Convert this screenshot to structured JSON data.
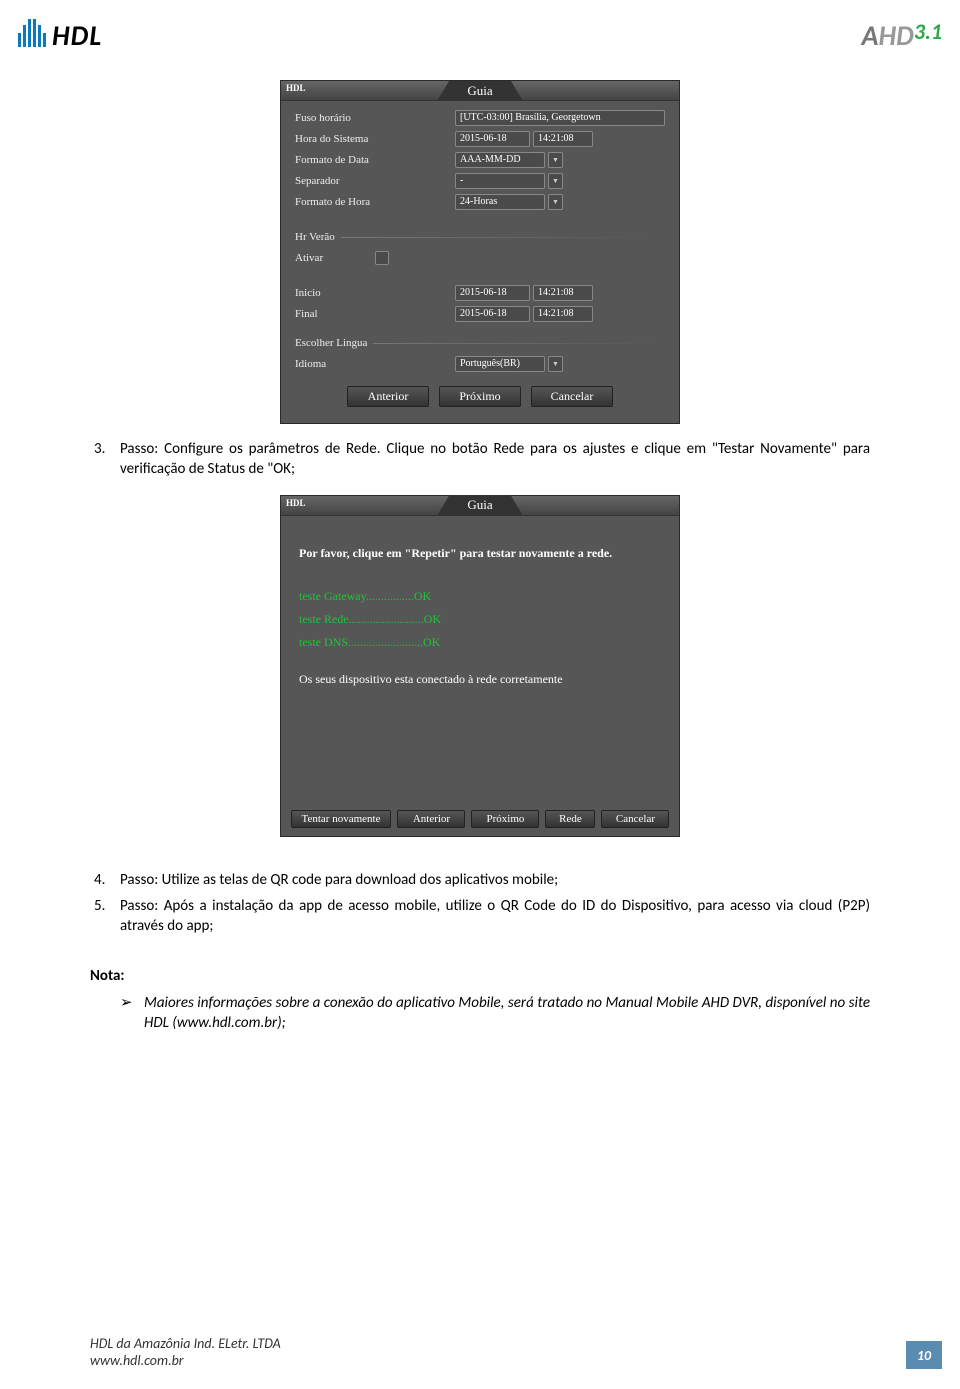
{
  "header": {
    "hdl_logo_text": "HDL",
    "ahd_a": "A",
    "ahd_hd": "HD",
    "ahd_ver": "3.1"
  },
  "screenshot1": {
    "mini_logo": "HDL",
    "title": "Guia",
    "rows": {
      "tz_label": "Fuso horário",
      "tz_value": "[UTC-03:00] Brasília, Georgetown",
      "systime_label": "Hora do Sistema",
      "systime_date": "2015-06-18",
      "systime_time": "14:21:08",
      "datefmt_label": "Formato de Data",
      "datefmt_value": "AAA-MM-DD",
      "sep_label": "Separador",
      "sep_value": "-",
      "timefmt_label": "Formato de Hora",
      "timefmt_value": "24-Horas",
      "dst_label": "Hr Verão",
      "enable_label": "Ativar",
      "start_label": "Inicio",
      "start_date": "2015-06-18",
      "start_time": "14:21:08",
      "end_label": "Final",
      "end_date": "2015-06-18",
      "end_time": "14:21:08",
      "lang_label": "Escolher Lingua",
      "idiom_label": "Idioma",
      "idiom_value": "Português(BR)"
    },
    "buttons": {
      "prev": "Anterior",
      "next": "Próximo",
      "cancel": "Cancelar"
    }
  },
  "para3_num": "3.",
  "para3": "Passo: Configure os parâmetros de Rede. Clique no botão Rede para os ajustes e clique em \"Testar Novamente\" para verificação de Status de \"OK;",
  "screenshot2": {
    "mini_logo": "HDL",
    "title": "Guia",
    "prompt": "Por favor, clique em \"Repetir\" para testar novamente a rede.",
    "test_gateway": "teste Gateway................OK",
    "test_rede": "teste Rede.........................OK",
    "test_dns": "teste DNS.........................OK",
    "status": "Os seus dispositivo esta conectado à rede corretamente",
    "buttons": {
      "retry": "Tentar novamente",
      "prev": "Anterior",
      "next": "Próximo",
      "net": "Rede",
      "cancel": "Cancelar"
    }
  },
  "para4_num": "4.",
  "para4": "Passo: Utilize as telas de QR code para download dos aplicativos mobile;",
  "para5_num": "5.",
  "para5": "Passo: Após a instalação da app de acesso mobile, utilize o QR Code do ID do Dispositivo, para acesso via cloud (P2P) através do app;",
  "nota_title": "Nota:",
  "nota_bullet": "Maiores informações sobre a conexão do aplicativo Mobile, será tratado no Manual Mobile AHD DVR, disponível no site HDL (www.hdl.com.br);",
  "footer": {
    "line1": "HDL da Amazônia Ind. ELetr. LTDA",
    "line2": "www.hdl.com.br",
    "page": "10"
  }
}
